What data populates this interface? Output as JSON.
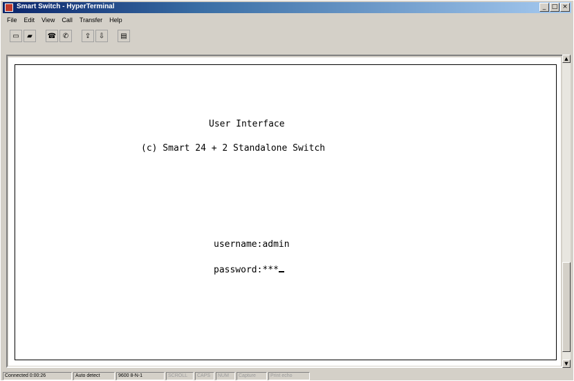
{
  "window": {
    "title": "Smart Switch - HyperTerminal",
    "minimize": "_",
    "maximize": "□",
    "close": "×"
  },
  "menu": {
    "items": [
      "File",
      "Edit",
      "View",
      "Call",
      "Transfer",
      "Help"
    ]
  },
  "toolbar": {
    "icons": [
      "new-icon",
      "open-icon",
      "connect-icon",
      "disconnect-icon",
      "send-icon",
      "receive-icon",
      "properties-icon"
    ]
  },
  "terminal": {
    "title_line": "User Interface",
    "subtitle_line": "(c) Smart 24 + 2 Standalone Switch",
    "username_label": "username:",
    "username_value": "admin",
    "password_label": "password:",
    "password_value": "***"
  },
  "status": {
    "connected": "Connected 0:00:26",
    "auto_detect": "Auto detect",
    "settings": "9600 8-N-1",
    "scroll": "SCROLL",
    "caps": "CAPS",
    "num": "NUM",
    "capture": "Capture",
    "print_echo": "Print echo"
  }
}
